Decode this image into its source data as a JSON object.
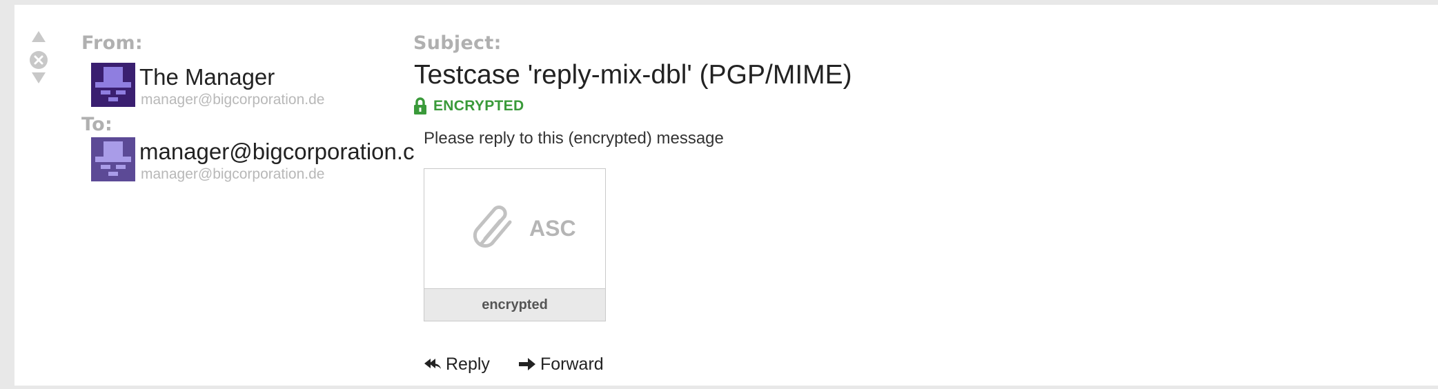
{
  "message": {
    "from_label": "From:",
    "to_label": "To:",
    "subject_label": "Subject:",
    "from": {
      "name": "The Manager",
      "email": "manager@bigcorporation.de"
    },
    "to": {
      "name": "manager@bigcorporation.c",
      "email": "manager@bigcorporation.de"
    },
    "subject": "Testcase 'reply-mix-dbl' (PGP/MIME)",
    "security_badge": "ENCRYPTED",
    "body": "Please reply to this (encrypted) message",
    "attachment": {
      "extension": "ASC",
      "name": "encrypted"
    }
  },
  "actions": {
    "reply": "Reply",
    "forward": "Forward"
  },
  "icons": {
    "nav_up": "triangle-up-icon",
    "close": "close-circle-icon",
    "nav_down": "triangle-down-icon",
    "lock": "lock-icon",
    "paperclip": "paperclip-icon",
    "reply": "reply-all-arrow-icon",
    "forward": "arrow-right-icon"
  },
  "colors": {
    "badge_green": "#3a9a3a",
    "avatar_dark": "#3a1f70",
    "avatar_light": "#5c4a96"
  }
}
